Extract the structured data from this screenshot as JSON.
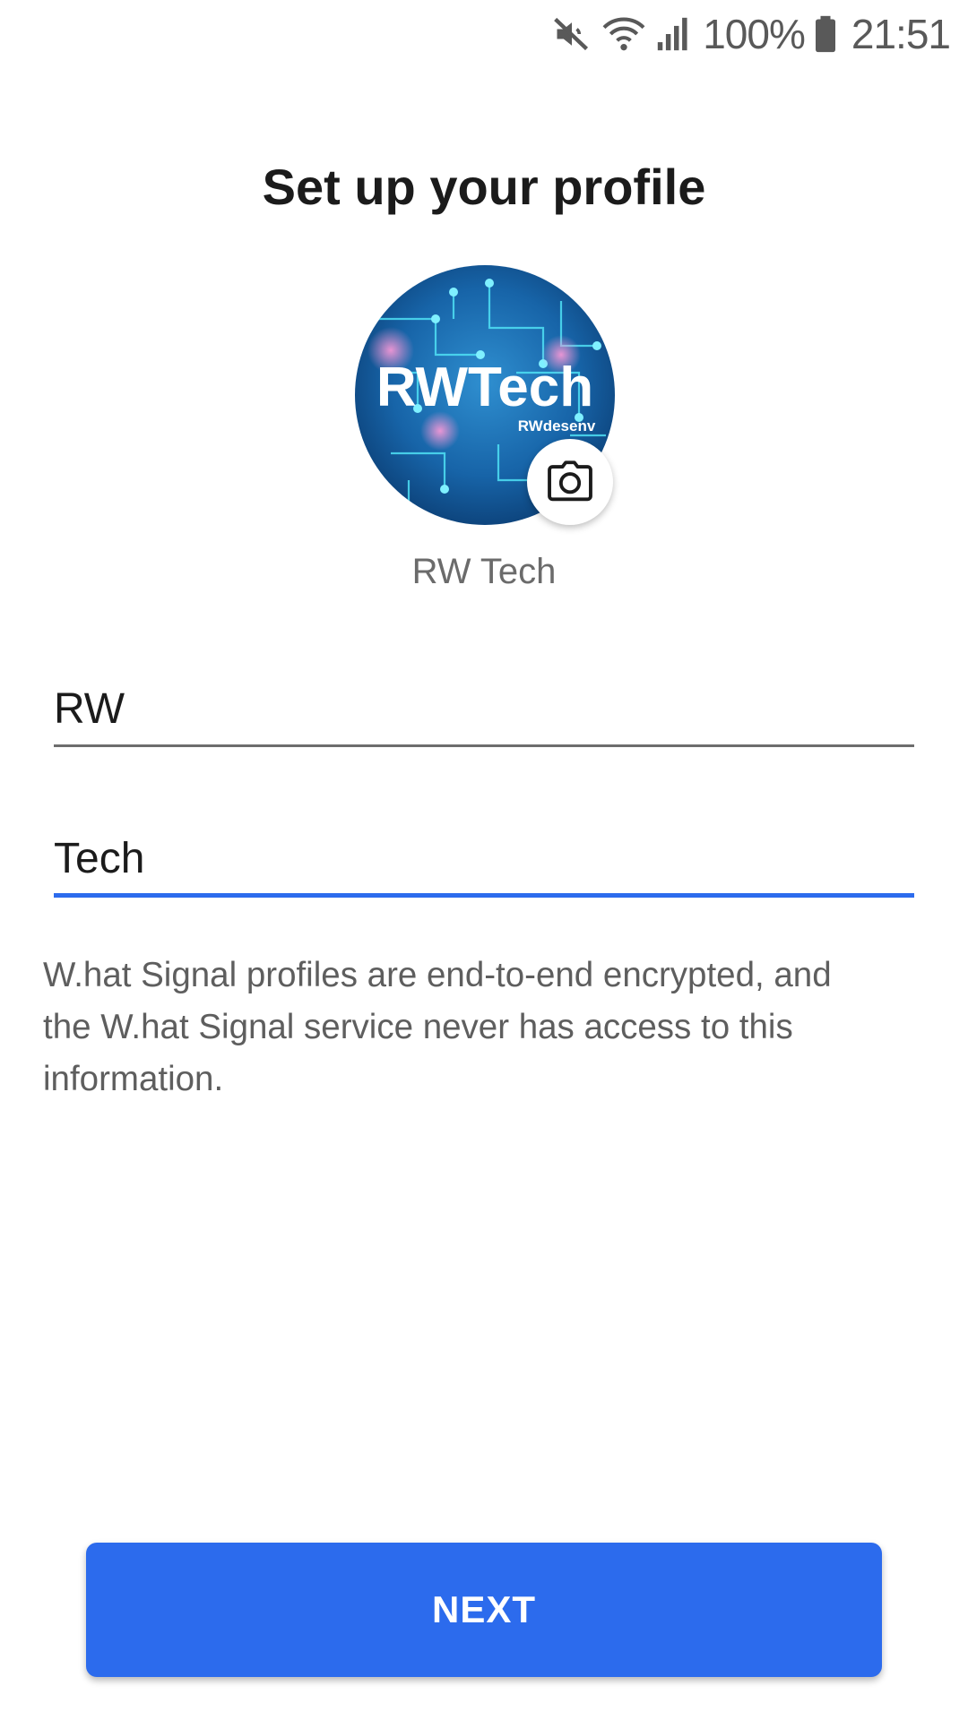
{
  "status_bar": {
    "battery": "100%",
    "time": "21:51",
    "icons": [
      "mute-icon",
      "wifi-icon",
      "signal-icon",
      "battery-icon"
    ]
  },
  "page": {
    "title": "Set up your profile"
  },
  "avatar": {
    "logo_text": "RWTech",
    "logo_subtext": "RWdesenv",
    "camera_icon": "camera-icon"
  },
  "profile": {
    "display_name": "RW Tech"
  },
  "form": {
    "first_name_value": "RW",
    "last_name_value": "Tech"
  },
  "info": {
    "text": "W.hat Signal profiles are end-to-end encrypted, and the W.hat Signal service never has access to this information."
  },
  "actions": {
    "next_label": "NEXT"
  },
  "colors": {
    "accent": "#2c6bed",
    "text_primary": "#1b1b1b",
    "text_secondary": "#5e5e5e"
  }
}
